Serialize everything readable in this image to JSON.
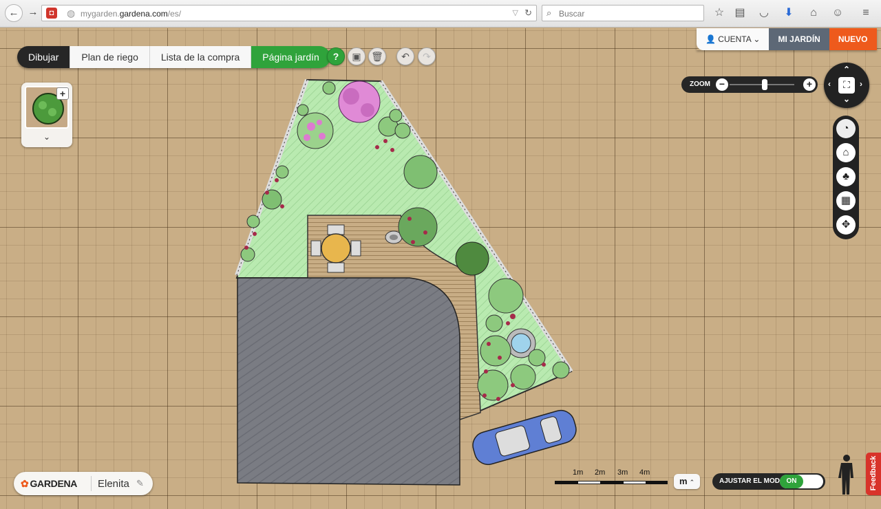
{
  "browser": {
    "back_icon": "back-arrow-icon",
    "forward_icon": "forward-arrow-icon",
    "url_prefix": "mygarden.",
    "url_domain": "gardena.com",
    "url_suffix": "/es/",
    "search_placeholder": "Buscar",
    "reload_glyph": "C",
    "toolbar_icons": [
      "star-icon",
      "reading-list-icon",
      "pocket-icon",
      "download-icon",
      "home-icon",
      "chat-icon",
      "menu-icon"
    ]
  },
  "tabs": {
    "draw": "Dibujar",
    "irrigation": "Plan de riego",
    "shopping": "Lista de la compra",
    "garden_page": "Página jardín"
  },
  "tools": {
    "help": "?"
  },
  "account": {
    "cuenta": "CUENTA",
    "mi_jardin": "MI JARDÍN",
    "nuevo": "NUEVO"
  },
  "zoom": {
    "label": "ZOOM",
    "minus": "−",
    "plus": "+",
    "level": 0.55
  },
  "palette": {
    "plus": "+"
  },
  "brand": {
    "logo": "GARDENA",
    "garden_name": "Elenita"
  },
  "scale": {
    "ticks": [
      "1m",
      "2m",
      "3m",
      "4m"
    ]
  },
  "unit": {
    "value": "m"
  },
  "adjust": {
    "label": "AJUSTAR EL MODO",
    "state": "ON"
  },
  "feedback": "Feedback",
  "colors": {
    "accent_green": "#2fa33b",
    "accent_orange": "#ee5a1c",
    "dark": "#262626",
    "account_blue": "#5d6876",
    "feedback_red": "#d8332a"
  }
}
